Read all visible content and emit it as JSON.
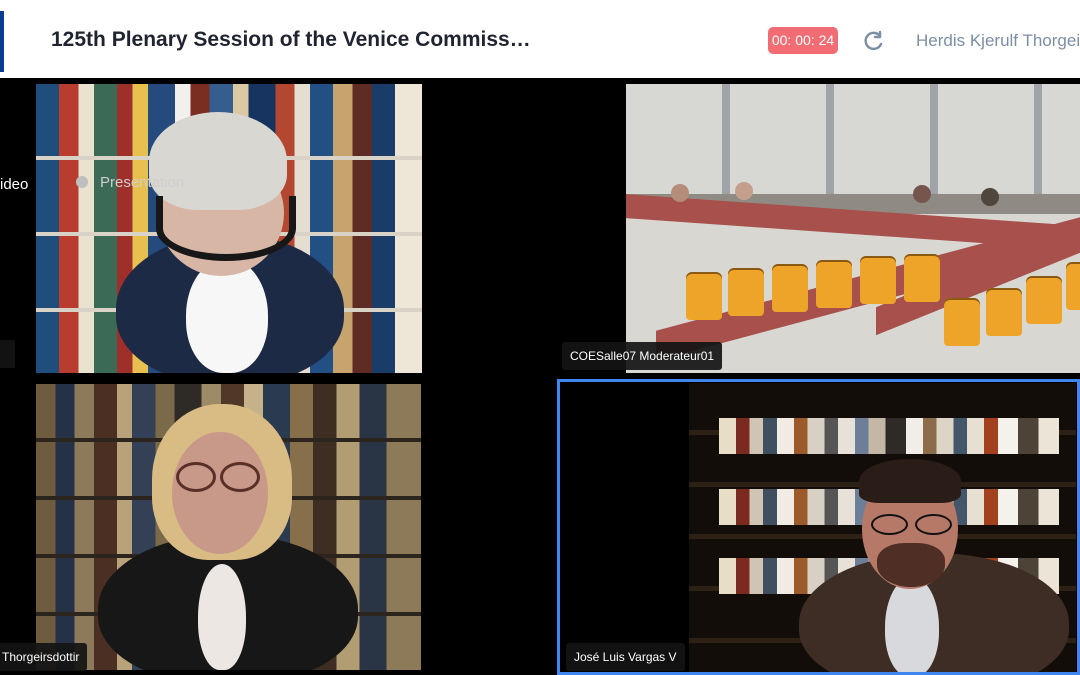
{
  "header": {
    "title": "125th Plenary Session of the Venice Commiss…",
    "timer": "00: 00: 24",
    "user": "Herdis Kjerulf Thorgeirs",
    "icons": {
      "refresh": "refresh-icon",
      "logo": "venice-commission-logo"
    }
  },
  "tiles": [
    {
      "label_left": "ideo",
      "overlay_label": "Presentation"
    },
    {
      "name": "COESalle07 Moderateur01"
    },
    {
      "name": "Thorgeirsdottir"
    },
    {
      "name": "José Luis Vargas V"
    }
  ],
  "colors": {
    "timer_bg": "#f26c73",
    "user_text": "#7b8ea4",
    "selected_border": "#3f86f1"
  }
}
